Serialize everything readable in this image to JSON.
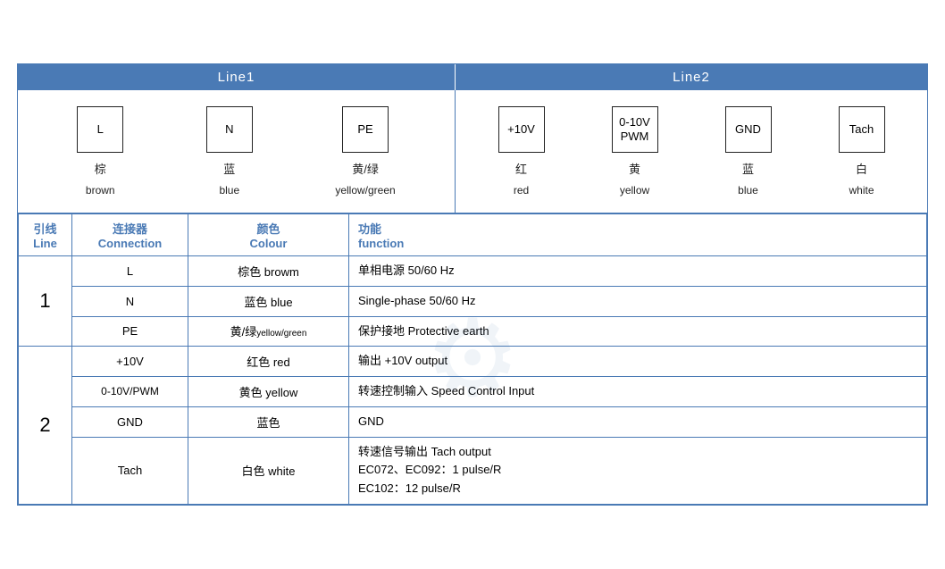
{
  "header": {
    "line1": "Line1",
    "line2": "Line2"
  },
  "diagram": {
    "line1_connectors": [
      {
        "id": "L",
        "label_cn": "棕",
        "label_en": "brown"
      },
      {
        "id": "N",
        "label_cn": "蓝",
        "label_en": "blue"
      },
      {
        "id": "PE",
        "label_cn": "黄/绿",
        "label_en": "yellow/green"
      }
    ],
    "line2_connectors": [
      {
        "id": "+10V",
        "label_cn": "红",
        "label_en": "red"
      },
      {
        "id_line1": "0-10V",
        "id_line2": "PWM",
        "label_cn": "黄",
        "label_en": "yellow"
      },
      {
        "id": "GND",
        "label_cn": "蓝",
        "label_en": "blue"
      },
      {
        "id": "Tach",
        "label_cn": "白",
        "label_en": "white"
      }
    ]
  },
  "table": {
    "headers": {
      "line_cn": "引线",
      "line_en": "Line",
      "conn_cn": "连接器",
      "conn_en": "Connection",
      "color_cn": "颜色",
      "color_en": "Colour",
      "func_cn": "功能",
      "func_en": "function"
    },
    "rows": [
      {
        "line_num": "1",
        "entries": [
          {
            "conn": "L",
            "color_cn": "棕色",
            "color_en": "browm",
            "func": "单相电源 50/60 Hz"
          },
          {
            "conn": "N",
            "color_cn": "蓝色",
            "color_en": "blue",
            "func": "Single-phase 50/60 Hz"
          },
          {
            "conn": "PE",
            "color_cn": "黄/绿",
            "color_en": "yellow/green",
            "func": "保护接地 Protective earth"
          }
        ]
      },
      {
        "line_num": "2",
        "entries": [
          {
            "conn": "+10V",
            "color_cn": "红色",
            "color_en": "red",
            "func": "输出 +10V output"
          },
          {
            "conn": "0-10V/PWM",
            "color_cn": "黄色",
            "color_en": "yellow",
            "func": "转速控制输入 Speed Control Input"
          },
          {
            "conn": "GND",
            "color_cn": "蓝色",
            "color_en": "",
            "func": "GND"
          },
          {
            "conn": "Tach",
            "color_cn": "白色",
            "color_en": "white",
            "func_line1": "转速信号输出 Tach output",
            "func_line2": "EC072、EC092：1 pulse/R",
            "func_line3": "EC102：12 pulse/R"
          }
        ]
      }
    ]
  }
}
